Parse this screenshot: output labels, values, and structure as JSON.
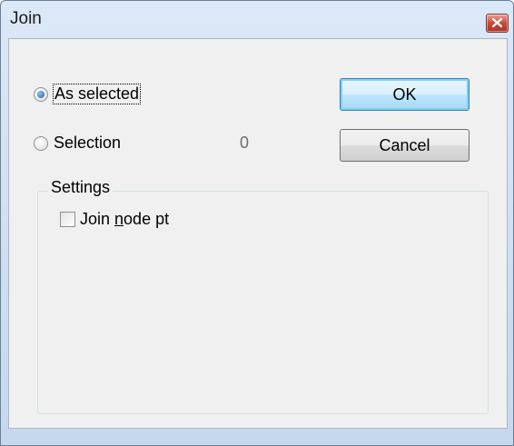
{
  "window": {
    "title": "Join"
  },
  "options": {
    "as_selected_label": "As selected",
    "selection_label": "Selection",
    "selection_count": "0",
    "selected": "as_selected"
  },
  "buttons": {
    "ok_label": "OK",
    "cancel_label": "Cancel"
  },
  "settings": {
    "group_label": "Settings",
    "join_node_pt_label_prefix": "Join ",
    "join_node_pt_mnemonic": "n",
    "join_node_pt_label_suffix": "ode pt",
    "join_node_pt_checked": false
  },
  "icons": {
    "close": "close-icon"
  },
  "colors": {
    "titlebar": "#dbe8f7",
    "close_button": "#c7493a",
    "dialog_background": "#f0f0f0",
    "default_button_border": "#3c7fb1"
  }
}
